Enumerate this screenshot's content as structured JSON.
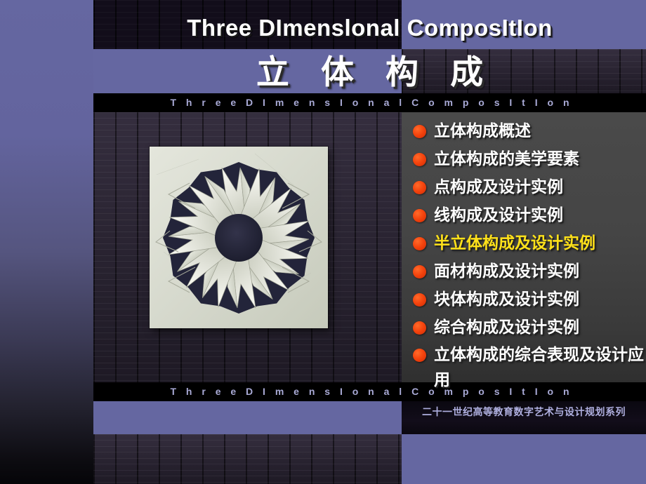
{
  "slide": {
    "title_en": "Three   DImenslonal  ComposItIon",
    "title_cn": "立 体 构 成",
    "subtitle_en_top": "T h r e e    D I m e n s I o n a l    C o m p o s I t I o n",
    "subtitle_en_bottom": "T h r e e   D I m e n s I o n a l  C o m p o s I t I o n",
    "series_label": "二十一世纪高等教育数字艺术与设计规划系列"
  },
  "colors": {
    "purple_band": "#6567a1",
    "subtitle_text": "#a9aad6",
    "bullet_dot": "#f4430d",
    "highlight_text": "#ffe11a",
    "bullet_text": "#ffffff",
    "panel_gray": "#4a4a4a"
  },
  "bullets": [
    {
      "label": "立体构成概述",
      "highlighted": false
    },
    {
      "label": "立体构成的美学要素",
      "highlighted": false
    },
    {
      "label": "点构成及设计实例",
      "highlighted": false
    },
    {
      "label": "线构成及设计实例",
      "highlighted": false
    },
    {
      "label": "半立体构成及设计实例",
      "highlighted": true
    },
    {
      "label": "面材构成及设计实例",
      "highlighted": false
    },
    {
      "label": "块体构成及设计实例",
      "highlighted": false
    },
    {
      "label": "综合构成及设计实例",
      "highlighted": false
    },
    {
      "label": " 立体构成的综合表现及设计应用",
      "highlighted": false
    }
  ],
  "photo": {
    "caption": "paper-cut radial star sculpture"
  }
}
